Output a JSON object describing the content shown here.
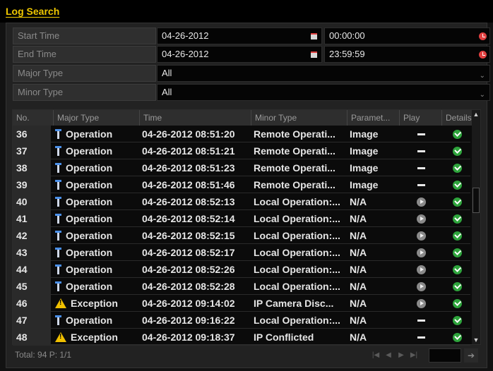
{
  "window": {
    "title": "Log Search"
  },
  "filters": {
    "start_time": {
      "label": "Start Time",
      "date": "04-26-2012",
      "time": "00:00:00"
    },
    "end_time": {
      "label": "End Time",
      "date": "04-26-2012",
      "time": "23:59:59"
    },
    "major_type": {
      "label": "Major Type",
      "value": "All"
    },
    "minor_type": {
      "label": "Minor Type",
      "value": "All"
    }
  },
  "table": {
    "columns": [
      "No.",
      "Major Type",
      "Time",
      "Minor Type",
      "Paramet...",
      "Play",
      "Details"
    ],
    "rows": [
      {
        "no": "36",
        "major": "Operation",
        "icon": "operation-icon",
        "time": "04-26-2012 08:51:20",
        "minor": "Remote Operati...",
        "param": "Image",
        "play": "none",
        "details": "check"
      },
      {
        "no": "37",
        "major": "Operation",
        "icon": "operation-icon",
        "time": "04-26-2012 08:51:21",
        "minor": "Remote Operati...",
        "param": "Image",
        "play": "none",
        "details": "check"
      },
      {
        "no": "38",
        "major": "Operation",
        "icon": "operation-icon",
        "time": "04-26-2012 08:51:23",
        "minor": "Remote Operati...",
        "param": "Image",
        "play": "none",
        "details": "check"
      },
      {
        "no": "39",
        "major": "Operation",
        "icon": "operation-icon",
        "time": "04-26-2012 08:51:46",
        "minor": "Remote Operati...",
        "param": "Image",
        "play": "none",
        "details": "check"
      },
      {
        "no": "40",
        "major": "Operation",
        "icon": "operation-icon",
        "time": "04-26-2012 08:52:13",
        "minor": "Local Operation:...",
        "param": "N/A",
        "play": "play",
        "details": "check"
      },
      {
        "no": "41",
        "major": "Operation",
        "icon": "operation-icon",
        "time": "04-26-2012 08:52:14",
        "minor": "Local Operation:...",
        "param": "N/A",
        "play": "play",
        "details": "check"
      },
      {
        "no": "42",
        "major": "Operation",
        "icon": "operation-icon",
        "time": "04-26-2012 08:52:15",
        "minor": "Local Operation:...",
        "param": "N/A",
        "play": "play",
        "details": "check"
      },
      {
        "no": "43",
        "major": "Operation",
        "icon": "operation-icon",
        "time": "04-26-2012 08:52:17",
        "minor": "Local Operation:...",
        "param": "N/A",
        "play": "play",
        "details": "check"
      },
      {
        "no": "44",
        "major": "Operation",
        "icon": "operation-icon",
        "time": "04-26-2012 08:52:26",
        "minor": "Local Operation:...",
        "param": "N/A",
        "play": "play",
        "details": "check"
      },
      {
        "no": "45",
        "major": "Operation",
        "icon": "operation-icon",
        "time": "04-26-2012 08:52:28",
        "minor": "Local Operation:...",
        "param": "N/A",
        "play": "play",
        "details": "check"
      },
      {
        "no": "46",
        "major": "Exception",
        "icon": "warning-icon",
        "time": "04-26-2012 09:14:02",
        "minor": "IP Camera Disc...",
        "param": "N/A",
        "play": "play",
        "details": "check"
      },
      {
        "no": "47",
        "major": "Operation",
        "icon": "operation-icon",
        "time": "04-26-2012 09:16:22",
        "minor": "Local Operation:...",
        "param": "N/A",
        "play": "none",
        "details": "check"
      },
      {
        "no": "48",
        "major": "Exception",
        "icon": "warning-icon",
        "time": "04-26-2012 09:18:37",
        "minor": "IP Conflicted",
        "param": "N/A",
        "play": "none",
        "details": "check"
      }
    ]
  },
  "footer": {
    "total_text": "Total: 94  P: 1/1"
  },
  "colors": {
    "title": "#f0c800",
    "check": "#2ea43c",
    "warning": "#f0c000",
    "operation": "#4a8fe8"
  }
}
